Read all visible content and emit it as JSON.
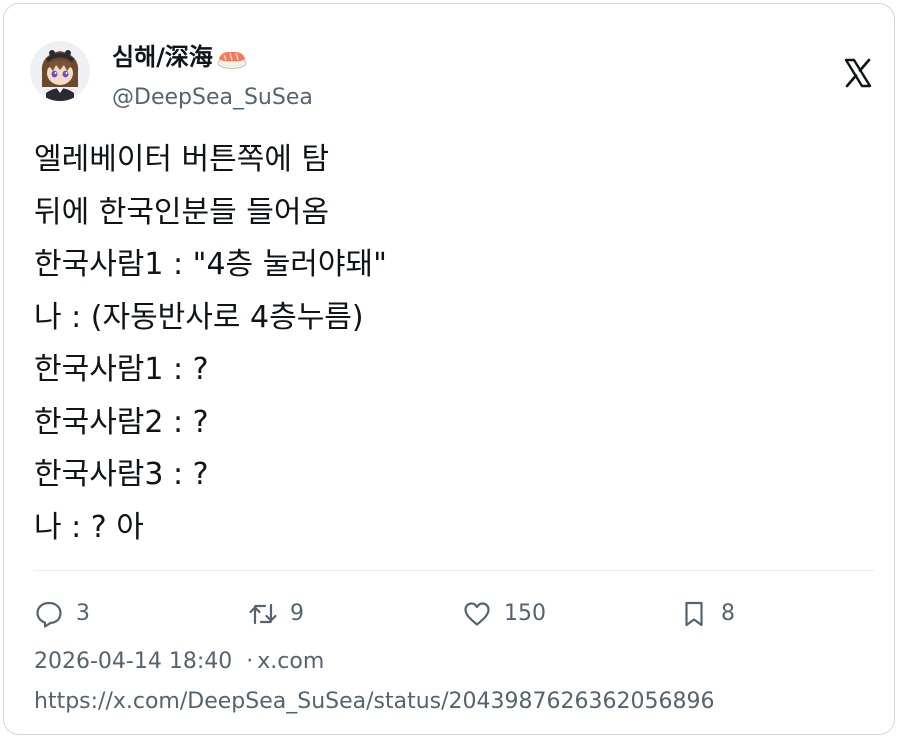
{
  "author": {
    "display_name": "심해/深海",
    "display_name_emoji": "sushi-emoji",
    "handle": "@DeepSea_SuSea",
    "avatar": "anime-avatar"
  },
  "platform_icon": "x-logo-icon",
  "tweet": {
    "lines": [
      "엘레베이터 버튼쪽에 탐",
      "뒤에 한국인분들 들어옴",
      "한국사람1 : \"4층 눌러야돼\"",
      "나 : (자동반사로 4층누름)",
      "한국사람1 : ?",
      "한국사람2 : ?",
      "한국사람3 : ?",
      "나 : ? 아"
    ]
  },
  "actions": {
    "replies": {
      "icon": "reply-icon",
      "count": "3"
    },
    "retweets": {
      "icon": "retweet-icon",
      "count": "9"
    },
    "likes": {
      "icon": "heart-icon",
      "count": "150"
    },
    "bookmarks": {
      "icon": "bookmark-icon",
      "count": "8"
    }
  },
  "meta": {
    "timestamp": "2026-04-14 18:40",
    "separator": "·",
    "source": "x.com"
  },
  "url": "https://x.com/DeepSea_SuSea/status/2043987626362056896",
  "colors": {
    "text": "#0f1419",
    "secondary": "#536471",
    "border": "#cfd9de"
  }
}
